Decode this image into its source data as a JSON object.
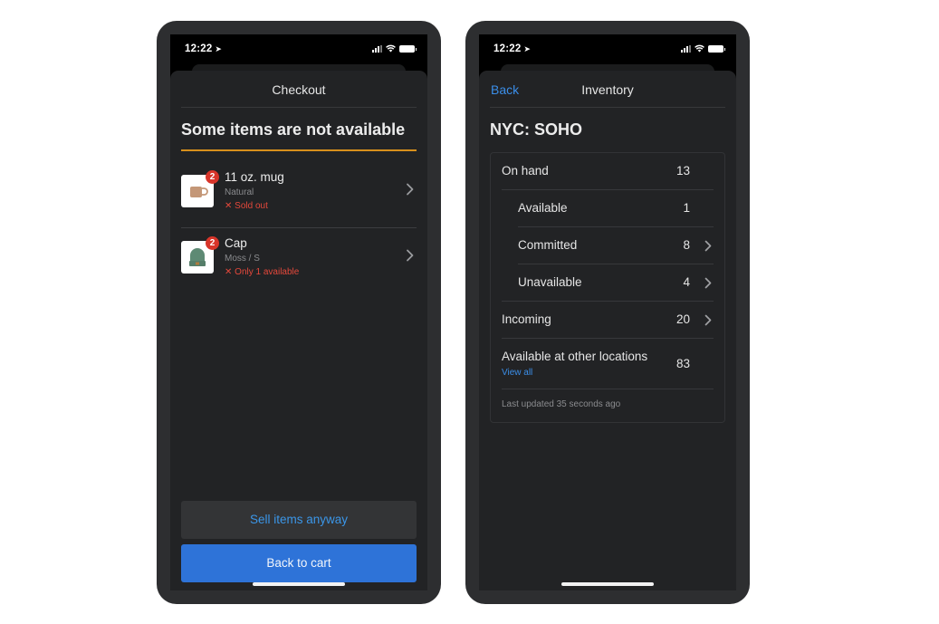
{
  "status_bar": {
    "time": "12:22"
  },
  "checkout": {
    "nav_title": "Checkout",
    "heading": "Some items are not available",
    "items": [
      {
        "name": "11 oz. mug",
        "variant": "Natural",
        "status": "Sold out",
        "badge": "2",
        "image": "mug-image"
      },
      {
        "name": "Cap",
        "variant": "Moss / S",
        "status": "Only 1 available",
        "badge": "2",
        "image": "cap-image"
      }
    ],
    "sell_anyway_label": "Sell items anyway",
    "back_to_cart_label": "Back to cart"
  },
  "inventory": {
    "back_label": "Back",
    "nav_title": "Inventory",
    "location": "NYC: SOHO",
    "rows": [
      {
        "label": "On hand",
        "value": "13",
        "indent": false,
        "chevron": false
      },
      {
        "label": "Available",
        "value": "1",
        "indent": true,
        "chevron": false
      },
      {
        "label": "Committed",
        "value": "8",
        "indent": true,
        "chevron": true
      },
      {
        "label": "Unavailable",
        "value": "4",
        "indent": true,
        "chevron": true
      },
      {
        "label": "Incoming",
        "value": "20",
        "indent": false,
        "chevron": true
      },
      {
        "label": "Available at other locations",
        "value": "83",
        "indent": false,
        "chevron": false,
        "link": "View all"
      }
    ],
    "last_updated": "Last updated 35 seconds ago"
  },
  "colors": {
    "accent_blue": "#3b8ee8",
    "primary_button": "#2e73d8",
    "warning_rule": "#d8901c",
    "error_red": "#e5483b",
    "badge_red": "#d8352a"
  }
}
